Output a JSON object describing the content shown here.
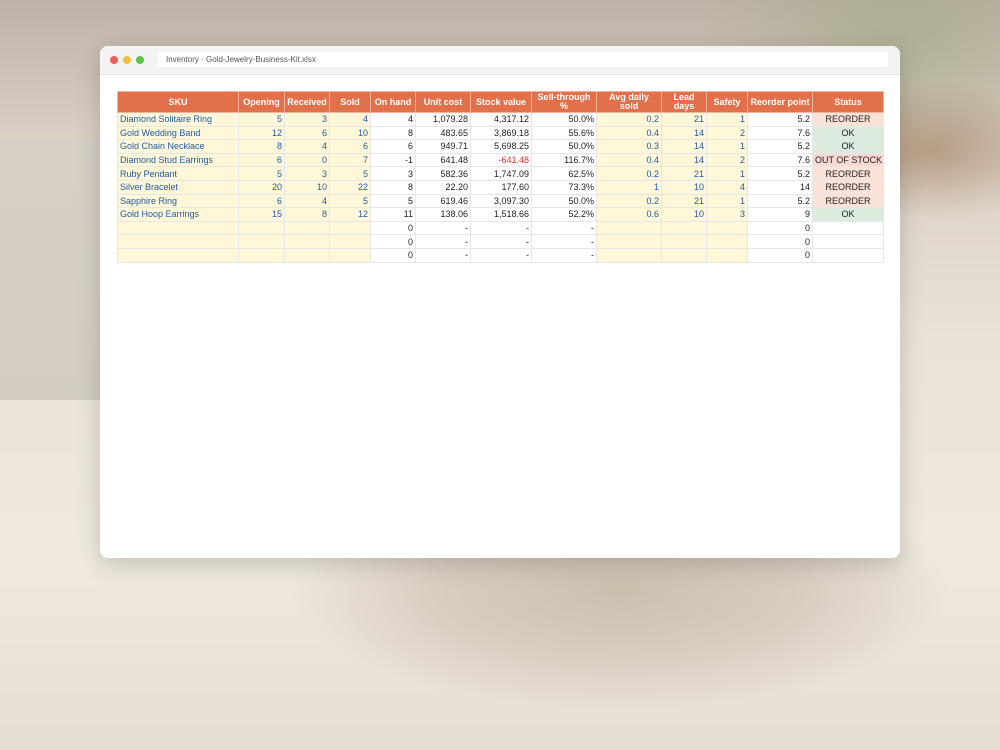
{
  "window": {
    "title": "Inventory · Gold-Jewelry-Business-Kit.xlsx"
  },
  "table": {
    "headers": [
      "SKU",
      "Opening",
      "Received",
      "Sold",
      "On hand",
      "Unit cost",
      "Stock value",
      "Sell-through %",
      "Avg daily sold",
      "Lead days",
      "Safety",
      "Reorder point",
      "Status"
    ],
    "rows": [
      [
        "Diamond Solitaire Ring",
        "5",
        "3",
        "4",
        "4",
        "1,079.28",
        "4,317.12",
        "50.0%",
        "0.2",
        "21",
        "1",
        "5.2",
        "REORDER"
      ],
      [
        "Gold Wedding Band",
        "12",
        "6",
        "10",
        "8",
        "483.65",
        "3,869.18",
        "55.6%",
        "0.4",
        "14",
        "2",
        "7.6",
        "OK"
      ],
      [
        "Gold Chain Necklace",
        "8",
        "4",
        "6",
        "6",
        "949.71",
        "5,698.25",
        "50.0%",
        "0.3",
        "14",
        "1",
        "5.2",
        "OK"
      ],
      [
        "Diamond Stud Earrings",
        "6",
        "0",
        "7",
        "-1",
        "641.48",
        "-641.48",
        "116.7%",
        "0.4",
        "14",
        "2",
        "7.6",
        "OUT OF STOCK"
      ],
      [
        "Ruby Pendant",
        "5",
        "3",
        "5",
        "3",
        "582.36",
        "1,747.09",
        "62.5%",
        "0.2",
        "21",
        "1",
        "5.2",
        "REORDER"
      ],
      [
        "Silver Bracelet",
        "20",
        "10",
        "22",
        "8",
        "22.20",
        "177.60",
        "73.3%",
        "1",
        "10",
        "4",
        "14",
        "REORDER"
      ],
      [
        "Sapphire Ring",
        "6",
        "4",
        "5",
        "5",
        "619.46",
        "3,097.30",
        "50.0%",
        "0.2",
        "21",
        "1",
        "5.2",
        "REORDER"
      ],
      [
        "Gold Hoop Earrings",
        "15",
        "8",
        "12",
        "11",
        "138.06",
        "1,518.66",
        "52.2%",
        "0.6",
        "10",
        "3",
        "9",
        "OK"
      ],
      [
        "",
        "",
        "",
        "",
        "0",
        "-",
        "-",
        "-",
        "",
        "",
        "",
        "0",
        ""
      ],
      [
        "",
        "",
        "",
        "",
        "0",
        "-",
        "-",
        "-",
        "",
        "",
        "",
        "0",
        ""
      ],
      [
        "",
        "",
        "",
        "",
        "0",
        "-",
        "-",
        "-",
        "",
        "",
        "",
        "0",
        ""
      ]
    ]
  },
  "colors": {
    "header": "#e2704b",
    "input_fill": "#fff8d8",
    "input_text": "#1f5aa6",
    "negative": "#e0342c",
    "reorder": "#fbe2d6",
    "ok": "#dcebdd",
    "out_of_stock": "#f9d7d4"
  }
}
